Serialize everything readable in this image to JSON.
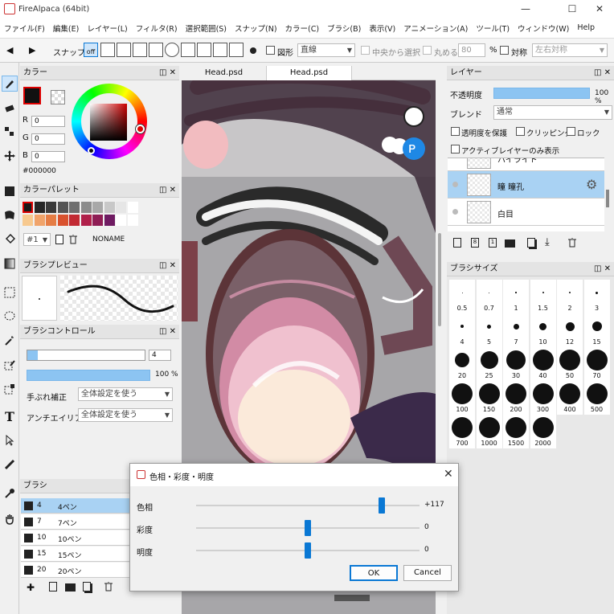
{
  "app": {
    "title": "FireAlpaca (64bit)"
  },
  "menu": [
    "ファイル(F)",
    "編集(E)",
    "レイヤー(L)",
    "フィルタ(R)",
    "選択範囲(S)",
    "スナップ(N)",
    "カラー(C)",
    "ブラシ(B)",
    "表示(V)",
    "アニメーション(A)",
    "ツール(T)",
    "ウィンドウ(W)",
    "Help"
  ],
  "toolbar": {
    "snap_label": "スナップ",
    "snap_off": "off",
    "figure_label": "図形",
    "figure_value": "直線",
    "center_select": "中央から選択",
    "round_label": "丸める",
    "round_value": "80",
    "percent": "%",
    "symmetry_label": "対称",
    "symmetry_value": "左右対称"
  },
  "color_panel": {
    "title": "カラー",
    "r_label": "R",
    "r": "0",
    "g_label": "G",
    "g": "0",
    "b_label": "B",
    "b": "0",
    "hex": "#000000"
  },
  "palette_panel": {
    "title": "カラーパレット",
    "number": "#1",
    "name": "NONAME",
    "row1": [
      "#1a1a1a",
      "#262626",
      "#3a3a3a",
      "#555555",
      "#6f6f6f",
      "#8c8c8c",
      "#a8a8a8",
      "#c8c8c8",
      "#e6e6e6",
      "#ffffff"
    ],
    "row2": [
      "#f7c98f",
      "#f0a36a",
      "#e57d45",
      "#d9522e",
      "#c22a33",
      "#b0204a",
      "#8f1d55",
      "#6f1b62",
      "#ffffff",
      "#ffffff"
    ]
  },
  "brush_preview": {
    "title": "ブラシプレビュー"
  },
  "brush_control": {
    "title": "ブラシコントロール",
    "size": "4",
    "opacity": "100 %",
    "stabilizer_label": "手ぶれ補正",
    "stabilizer_value": "全体設定を使う",
    "antialias_label": "アンチエイリアス",
    "antialias_value": "全体設定を使う"
  },
  "brush_list": {
    "title": "ブラシ",
    "items": [
      {
        "size": "4",
        "name": "4ペン",
        "selected": true
      },
      {
        "size": "7",
        "name": "7ペン",
        "selected": false
      },
      {
        "size": "10",
        "name": "10ペン",
        "selected": false
      },
      {
        "size": "15",
        "name": "15ペン",
        "selected": false
      },
      {
        "size": "20",
        "name": "20ペン",
        "selected": false
      }
    ]
  },
  "canvas": {
    "tabs": [
      "Head.psd",
      "Head.psd"
    ],
    "active_tab": 1
  },
  "layer_panel": {
    "title": "レイヤー",
    "opacity_label": "不透明度",
    "opacity_value": "100 %",
    "blend_label": "ブレンド",
    "blend_value": "通常",
    "protect_alpha": "透明度を保護",
    "clipping": "クリッピング",
    "lock": "ロック",
    "active_only": "アクティブレイヤーのみ表示",
    "layers": [
      {
        "name": "ハイライト",
        "selected": false
      },
      {
        "name": "瞳 瞳孔",
        "selected": true
      },
      {
        "name": "白目",
        "selected": false
      }
    ]
  },
  "brush_size_panel": {
    "title": "ブラシサイズ",
    "sizes": [
      "0.5",
      "0.7",
      "1",
      "1.5",
      "2",
      "3",
      "4",
      "5",
      "7",
      "10",
      "12",
      "15",
      "20",
      "25",
      "30",
      "40",
      "50",
      "70",
      "100",
      "150",
      "200",
      "300",
      "400",
      "500",
      "700",
      "1000",
      "1500",
      "2000"
    ]
  },
  "dialog": {
    "title": "色相・彩度・明度",
    "hue_label": "色相",
    "hue_value": "+117",
    "hue_level": 0.83,
    "saturation_label": "彩度",
    "saturation_value": "0",
    "saturation_level": 0.5,
    "lightness_label": "明度",
    "lightness_value": "0",
    "lightness_level": 0.5,
    "ok": "OK",
    "cancel": "Cancel"
  }
}
